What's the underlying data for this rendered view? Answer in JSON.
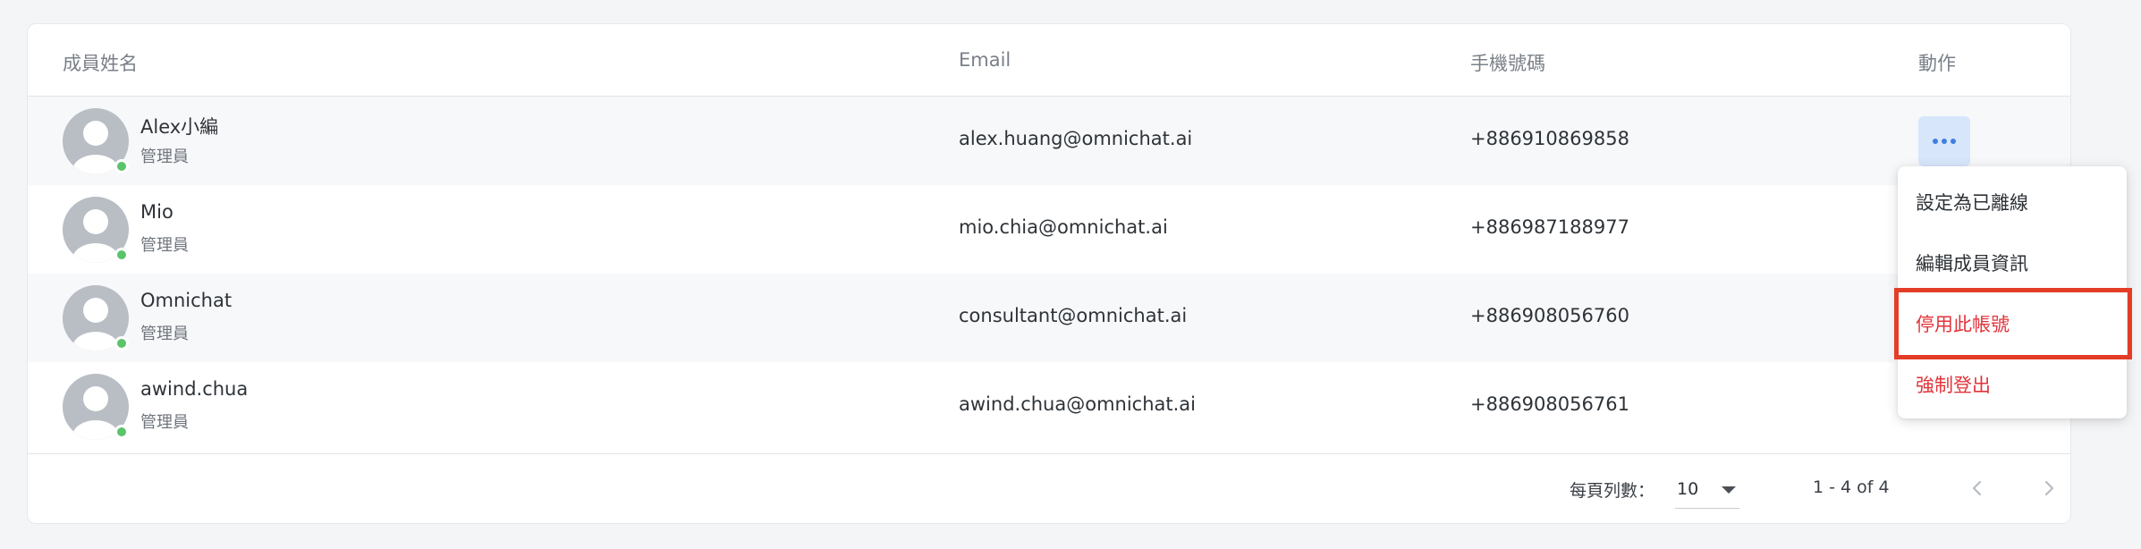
{
  "table": {
    "headers": {
      "name": "成員姓名",
      "email": "Email",
      "phone": "手機號碼",
      "actions": "動作"
    },
    "rows": [
      {
        "name": "Alex小編",
        "role": "管理員",
        "email": "alex.huang@omnichat.ai",
        "phone": "+886910869858",
        "status": "online"
      },
      {
        "name": "Mio",
        "role": "管理員",
        "email": "mio.chia@omnichat.ai",
        "phone": "+886987188977",
        "status": "online"
      },
      {
        "name": "Omnichat",
        "role": "管理員",
        "email": "consultant@omnichat.ai",
        "phone": "+886908056760",
        "status": "online"
      },
      {
        "name": "awind.chua",
        "role": "管理員",
        "email": "awind.chua@omnichat.ai",
        "phone": "+886908056761",
        "status": "online"
      }
    ]
  },
  "action_menu": {
    "items": [
      {
        "label": "設定為已離線",
        "style": "normal"
      },
      {
        "label": "編輯成員資訊",
        "style": "normal"
      },
      {
        "label": "停用此帳號",
        "style": "danger",
        "highlighted": true
      },
      {
        "label": "強制登出",
        "style": "danger"
      }
    ]
  },
  "pagination": {
    "rows_per_page_label": "每頁列數：",
    "rows_per_page_value": "10",
    "range_text": "1 - 4 of 4"
  },
  "icons": {
    "more": "more-horizontal-icon",
    "avatar": "user-avatar-icon",
    "prev": "chevron-left-icon",
    "next": "chevron-right-icon",
    "caret": "caret-down-icon"
  },
  "colors": {
    "online": "#5ac46a",
    "danger": "#e0343a",
    "highlight_border": "#e33d28",
    "accent_button": "#d8e6fb"
  }
}
